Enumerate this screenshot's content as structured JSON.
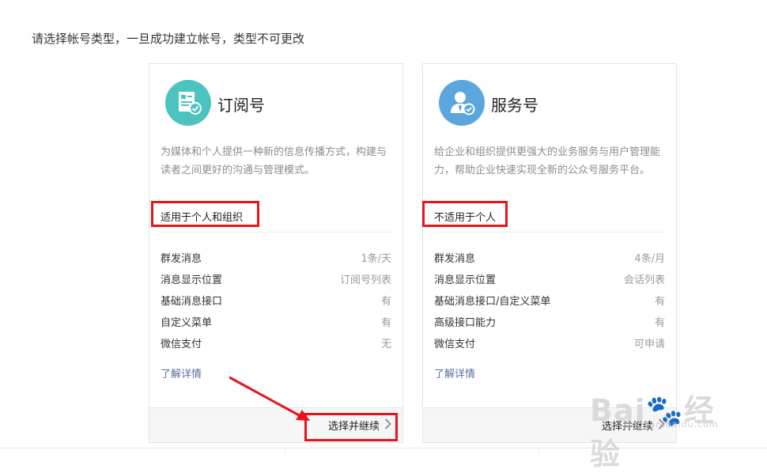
{
  "heading": "请选择帐号类型，一旦成功建立帐号，类型不可更改",
  "cards": [
    {
      "title": "订阅号",
      "icon": "subscription-document-icon",
      "icon_color": "#4dc3bf",
      "description": "为媒体和个人提供一种新的信息传播方式，构建与读者之间更好的沟通与管理模式。",
      "suitability": "适用于个人和组织",
      "features": [
        {
          "name": "群发消息",
          "value": "1条/天"
        },
        {
          "name": "消息显示位置",
          "value": "订阅号列表"
        },
        {
          "name": "基础消息接口",
          "value": "有"
        },
        {
          "name": "自定义菜单",
          "value": "有"
        },
        {
          "name": "微信支付",
          "value": "无"
        }
      ],
      "learn_more": "了解详情",
      "continue_label": "选择并继续"
    },
    {
      "title": "服务号",
      "icon": "service-person-icon",
      "icon_color": "#5aa6dd",
      "description": "给企业和组织提供更强大的业务服务与用户管理能力，帮助企业快速实现全新的公众号服务平台。",
      "suitability": "不适用于个人",
      "features": [
        {
          "name": "群发消息",
          "value": "4条/月"
        },
        {
          "name": "消息显示位置",
          "value": "会话列表"
        },
        {
          "name": "基础消息接口/自定义菜单",
          "value": "有"
        },
        {
          "name": "高级接口能力",
          "value": "有"
        },
        {
          "name": "微信支付",
          "value": "可申请"
        }
      ],
      "learn_more": "了解详情",
      "continue_label": "选择并继续"
    }
  ],
  "highlight_color": "#e8141c",
  "watermark": {
    "text": "Bai🐾经验",
    "sub": "jingyan.baidu.com"
  }
}
